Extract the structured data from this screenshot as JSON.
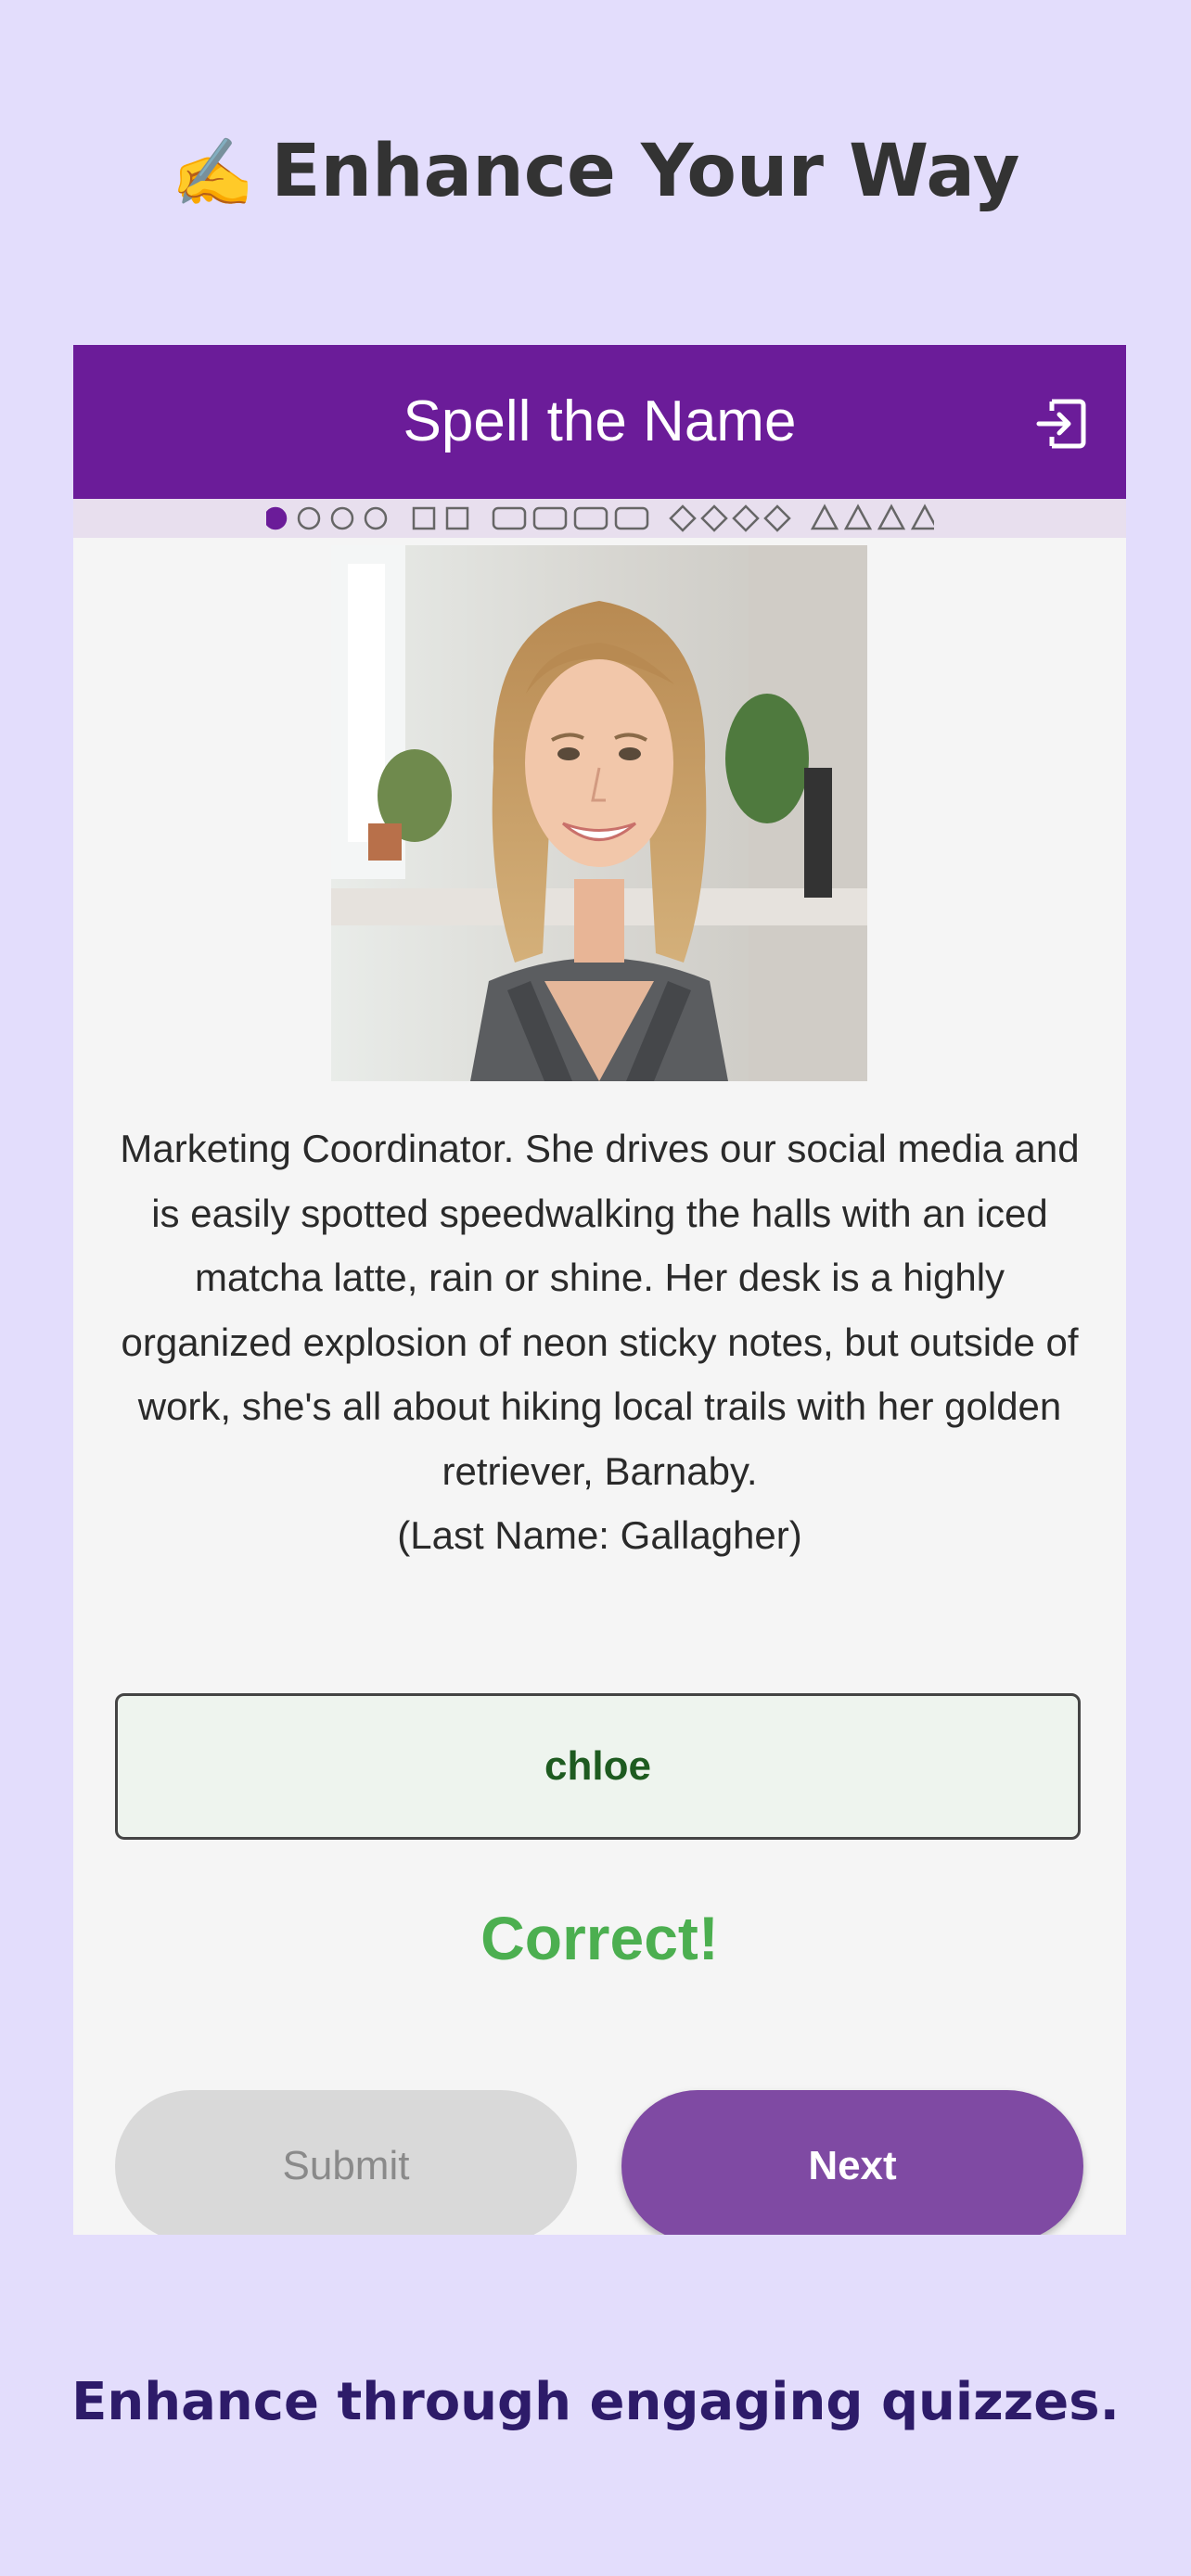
{
  "app": {
    "emoji": "✍️",
    "title": "Enhance Your Way",
    "tagline": "Enhance through engaging quizzes."
  },
  "quiz": {
    "header_title": "Spell the Name",
    "progress": {
      "current_index": 0,
      "groups": [
        {
          "shape": "circle",
          "count": 4
        },
        {
          "shape": "square",
          "count": 2
        },
        {
          "shape": "rounded-rect",
          "count": 4
        },
        {
          "shape": "diamond",
          "count": 4
        },
        {
          "shape": "triangle",
          "count": 4
        }
      ]
    },
    "photo_alt": "Portrait of a smiling woman with shoulder-length blonde hair in a grey blazer, office plants in the background",
    "bio": "Marketing Coordinator. She drives our social media and is easily spotted speedwalking the halls with an iced matcha latte, rain or shine. Her desk is a highly organized explosion of neon sticky notes, but outside of work, she's all about hiking local trails with her golden retriever, Barnaby.",
    "last_name_hint": "(Last Name: Gallagher)",
    "answer_value": "chloe",
    "feedback": "Correct!",
    "submit_label": "Submit",
    "next_label": "Next"
  },
  "colors": {
    "page_bg": "#e3ddfc",
    "header_bg": "#6b1c99",
    "progress_active": "#6b1c99",
    "progress_inactive": "#666666",
    "correct": "#4caf50",
    "next_button": "#7f4aa3",
    "tagline": "#2d1b69"
  },
  "icons": {
    "exit": "exit-door-icon"
  }
}
